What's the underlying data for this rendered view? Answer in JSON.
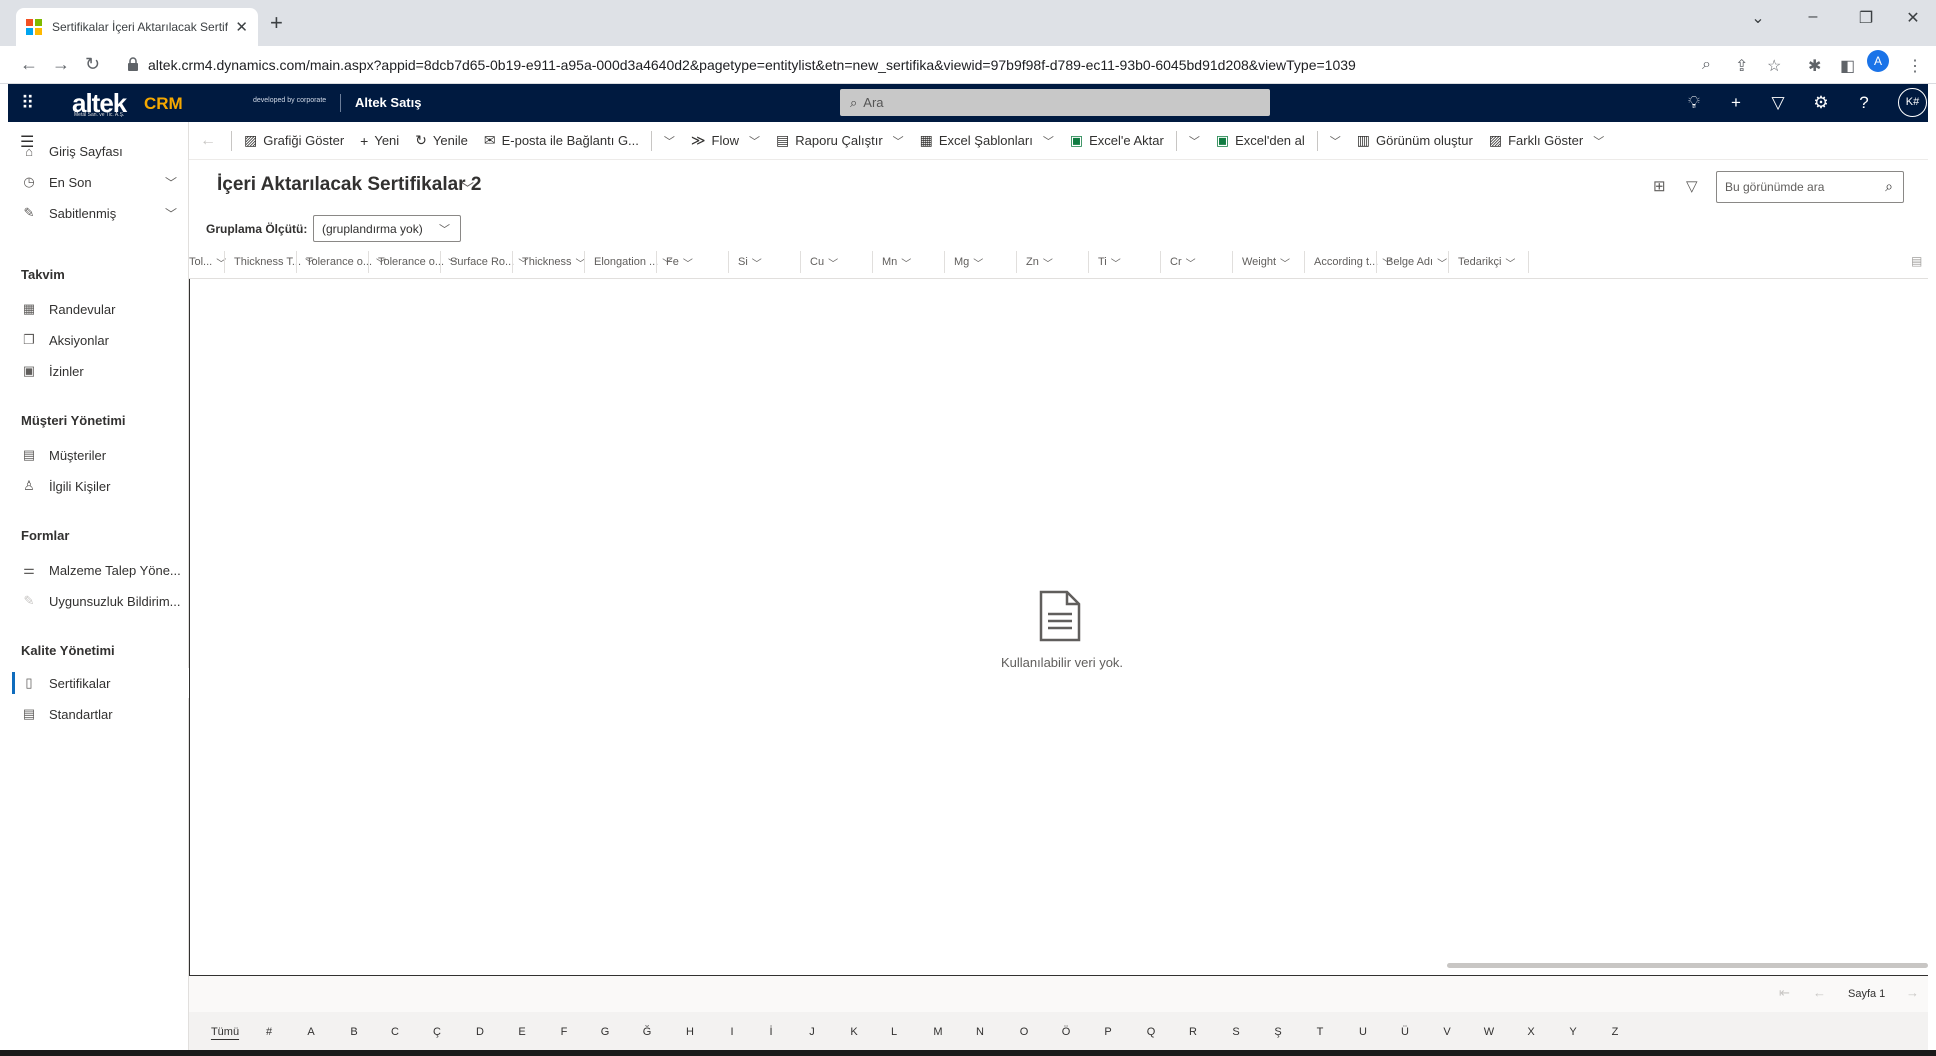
{
  "browser": {
    "tab_title": "Sertifikalar İçeri Aktarılacak Sertifi",
    "tab_close": "✕",
    "new_tab": "+",
    "url": "altek.crm4.dynamics.com/main.aspx?appid=8dcb7d65-0b19-e911-a95a-000d3a4640d2&pagetype=entitylist&etn=new_sertifika&viewid=97b9f98f-d789-ec11-93b0-6045bd91d208&viewType=1039",
    "profile_initial": "A"
  },
  "app": {
    "logo_text": "altek",
    "logo_sub": "Metal San. ve Tic. A.Ş.",
    "logo_crm": "CRM",
    "developed_by": "developed by corporate",
    "app_name": "Altek Satış",
    "search_placeholder": "Ara",
    "user_initials": "K#"
  },
  "sidebar": {
    "items_top": [
      {
        "label": "Giriş Sayfası",
        "icon": "home-icon"
      },
      {
        "label": "En Son",
        "icon": "clock-icon"
      },
      {
        "label": "Sabitlenmiş",
        "icon": "pin-icon"
      }
    ],
    "groups": [
      {
        "title": "Takvim",
        "items": [
          {
            "label": "Randevular",
            "icon": "calendar-icon"
          },
          {
            "label": "Aksiyonlar",
            "icon": "copy-icon"
          },
          {
            "label": "İzinler",
            "icon": "leave-icon"
          }
        ]
      },
      {
        "title": "Müşteri Yönetimi",
        "items": [
          {
            "label": "Müşteriler",
            "icon": "account-icon"
          },
          {
            "label": "İlgili Kişiler",
            "icon": "person-icon"
          }
        ]
      },
      {
        "title": "Formlar",
        "items": [
          {
            "label": "Malzeme Talep Yöne...",
            "icon": "request-icon"
          },
          {
            "label": "Uygunsuzluk Bildirim...",
            "icon": "form-icon"
          }
        ]
      },
      {
        "title": "Kalite Yönetimi",
        "items": [
          {
            "label": "Sertifikalar",
            "icon": "certificate-icon",
            "selected": true
          },
          {
            "label": "Standartlar",
            "icon": "document-icon"
          }
        ]
      }
    ]
  },
  "commands": {
    "show_chart": "Grafiği Göster",
    "new": "Yeni",
    "refresh": "Yenile",
    "email_link": "E-posta ile Bağlantı G...",
    "flow": "Flow",
    "run_report": "Raporu Çalıştır",
    "excel_templates": "Excel Şablonları",
    "export_excel": "Excel'e Aktar",
    "import_excel": "Excel'den al",
    "create_view": "Görünüm oluştur",
    "show_as": "Farklı Göster"
  },
  "view": {
    "title": "İçeri Aktarılacak Sertifikalar 2",
    "grouping_label": "Gruplama Ölçütü:",
    "grouping_value": "(gruplandırma yok)",
    "search_placeholder": "Bu görünümde ara",
    "empty_text": "Kullanılabilir veri yok."
  },
  "columns": [
    "Tol...",
    "Thickness T...",
    "Tolerance o...",
    "Tolerance o...",
    "Surface Ro...",
    "Thickness",
    "Elongation ...",
    "Fe",
    "Si",
    "Cu",
    "Mn",
    "Mg",
    "Zn",
    "Ti",
    "Cr",
    "Weight",
    "According t...",
    "Belge Adı",
    "Tedarikçi"
  ],
  "pager": {
    "page_label": "Sayfa 1"
  },
  "jump_letters": [
    "Tümü",
    "#",
    "A",
    "B",
    "C",
    "Ç",
    "D",
    "E",
    "F",
    "G",
    "Ğ",
    "H",
    "I",
    "İ",
    "J",
    "K",
    "L",
    "M",
    "N",
    "O",
    "Ö",
    "P",
    "Q",
    "R",
    "S",
    "Ş",
    "T",
    "U",
    "Ü",
    "V",
    "W",
    "X",
    "Y",
    "Z"
  ],
  "colors": {
    "header_bg": "#001a40",
    "accent": "#0f6cbd",
    "crm_orange": "#f5a800",
    "excel_green": "#107c41"
  }
}
